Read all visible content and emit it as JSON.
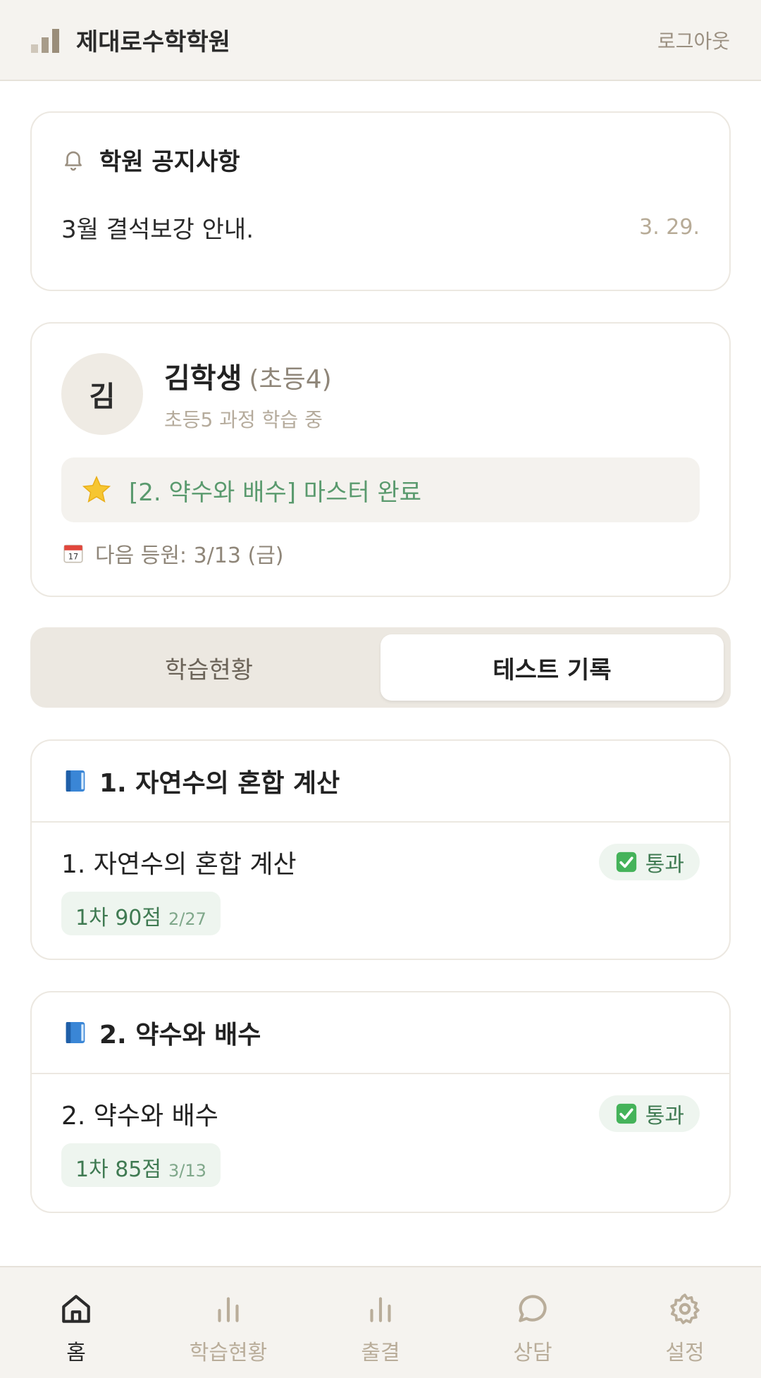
{
  "header": {
    "title": "제대로수학학원",
    "logout_label": "로그아웃"
  },
  "notice": {
    "title": "학원 공지사항",
    "text": "3월 결석보강 안내.",
    "date": "3. 29."
  },
  "student": {
    "avatar": "김",
    "name": "김학생",
    "grade": "(초등4)",
    "course": "초등5 과정 학습 중",
    "badge": "[2. 약수와 배수] 마스터 완료",
    "next_visit": "다음 등원: 3/13 (금)"
  },
  "tabs": [
    {
      "label": "학습현황",
      "active": false
    },
    {
      "label": "테스트 기록",
      "active": true
    }
  ],
  "units": [
    {
      "title": "1. 자연수의 혼합 계산",
      "item_name": "1. 자연수의 혼합 계산",
      "status": "통과",
      "score": "1차 90점",
      "score_date": "2/27"
    },
    {
      "title": "2. 약수와 배수",
      "item_name": "2. 약수와 배수",
      "status": "통과",
      "score": "1차 85점",
      "score_date": "3/13"
    }
  ],
  "bottom_nav": [
    {
      "label": "홈",
      "icon": "home-icon",
      "active": true
    },
    {
      "label": "학습현황",
      "icon": "bar-chart-icon",
      "active": false
    },
    {
      "label": "출결",
      "icon": "bar-chart-icon",
      "active": false
    },
    {
      "label": "상담",
      "icon": "chat-bubble-icon",
      "active": false
    },
    {
      "label": "설정",
      "icon": "gear-icon",
      "active": false
    }
  ],
  "colors": {
    "accent_green": "#3f7a52",
    "muted": "#b9ad9a",
    "background": "#f5f3ef"
  }
}
